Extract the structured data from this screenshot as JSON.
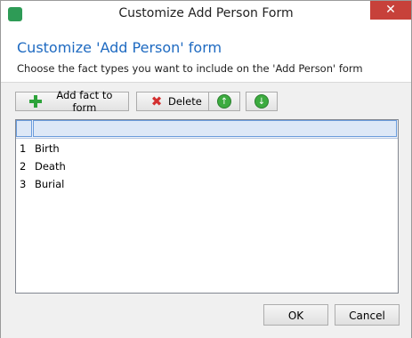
{
  "window": {
    "title": "Customize Add Person Form",
    "close_glyph": "✕"
  },
  "header": {
    "title": "Customize 'Add Person' form",
    "subtitle": "Choose the fact types you want to include on the 'Add Person' form"
  },
  "toolbar": {
    "add_label": "Add fact to form",
    "delete_label": "Delete",
    "up_glyph": "↑",
    "down_glyph": "↓"
  },
  "grid": {
    "rows": [
      {
        "num": "1",
        "label": "Birth"
      },
      {
        "num": "2",
        "label": "Death"
      },
      {
        "num": "3",
        "label": "Burial"
      }
    ]
  },
  "footer": {
    "ok_label": "OK",
    "cancel_label": "Cancel"
  },
  "colors": {
    "accent": "#1e6ac1",
    "close": "#c7413a",
    "plus": "#2da33a",
    "delete": "#d32f2f"
  }
}
